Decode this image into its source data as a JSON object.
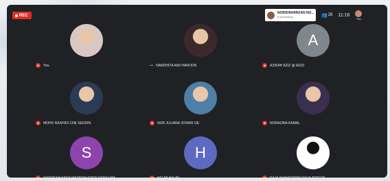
{
  "recording": {
    "label": "REC"
  },
  "presenter": {
    "name": "NORSHAHIRZAN NO...",
    "subtitle": "is presenting"
  },
  "participants_count": "28",
  "clock": "11:16",
  "self_label": "You",
  "tiles": [
    {
      "name": "You",
      "avatar_type": "photo",
      "photo_color": "#d9c8c2",
      "mic": "off"
    },
    {
      "name": "NARDHITA AINI HAROON",
      "avatar_type": "photo",
      "photo_color": "#3c2a2a",
      "mic": "on"
    },
    {
      "name": "AZIDAH AZIZ @ AZIZI",
      "avatar_type": "letter",
      "letter": "A",
      "color": "#80868b",
      "mic": "off"
    },
    {
      "name": "MOHD RASHIDI CHE SEDDIN",
      "avatar_type": "photo",
      "photo_color": "#2a3b55",
      "mic": "off"
    },
    {
      "name": "NOR JULIANA JOHARI OE",
      "avatar_type": "photo",
      "photo_color": "#4f7ea8",
      "mic": "off"
    },
    {
      "name": "NORAZINA KAMAL",
      "avatar_type": "photo",
      "photo_color": "#3a2f4f",
      "mic": "off"
    },
    {
      "name": "SHARIFAH SARA MAZIDAH SYED SYRALOM",
      "avatar_type": "letter",
      "letter": "S",
      "color": "#8e44ad",
      "mic": "off"
    },
    {
      "name": "HELMI HALIM",
      "avatar_type": "letter",
      "letter": "H",
      "color": "#5c6bc0",
      "mic": "off"
    },
    {
      "name": "RAJA SHAHERMAN RAJA ARIFFIN",
      "avatar_type": "photo",
      "photo_color": "#ffffff",
      "mic": "off"
    }
  ]
}
